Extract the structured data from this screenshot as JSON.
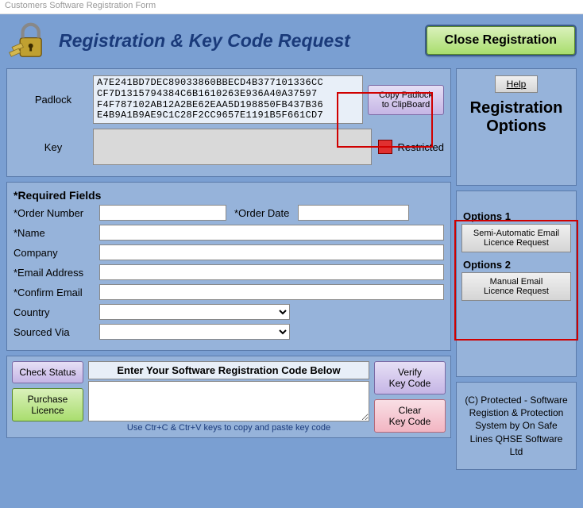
{
  "window_title": "Customers Software Registration Form",
  "header": {
    "title": "Registration & Key Code Request",
    "close_btn": "Close Registration"
  },
  "padlock_section": {
    "padlock_label": "Padlock",
    "padlock_code": "A7E241BD7DEC89033860BBECD4B377101336CC\nCF7D1315794384C6B1610263E936A40A37597\nF4F787102AB12A2BE62EAA5D198850FB437B36\nE4B9A1B9AE9C1C28F2CC9657E1191B5F661CD7",
    "copy_btn_l1": "Copy Padlock",
    "copy_btn_l2": "to ClipBoard",
    "key_label": "Key",
    "restricted": "Restricted"
  },
  "form": {
    "required_title": "*Required Fields",
    "order_number": "*Order Number",
    "order_date": "*Order Date",
    "name": "*Name",
    "company": "Company",
    "email": "*Email Address",
    "confirm": "*Confirm Email",
    "country": "Country",
    "sourced": "Sourced Via"
  },
  "bottom": {
    "check_status": "Check Status",
    "purchase": "Purchase\nLicence",
    "reg_title": "Enter Your Software Registration Code Below",
    "hint": "Use Ctr+C & Ctr+V keys to copy and paste key code",
    "verify_l1": "Verify",
    "verify_l2": "Key Code",
    "clear_l1": "Clear",
    "clear_l2": "Key Code"
  },
  "right": {
    "help": "Help",
    "reg_options": "Registration\nOptions",
    "opt1_label": "Options 1",
    "opt1_btn_l1": "Semi-Automatic Email",
    "opt1_btn_l2": "Licence Request",
    "opt2_label": "Options 2",
    "opt2_btn_l1": "Manual Email",
    "opt2_btn_l2": "Licence Request",
    "copyright": "(C) Protected - Software Registion & Protection System by On Safe Lines QHSE Software Ltd"
  }
}
